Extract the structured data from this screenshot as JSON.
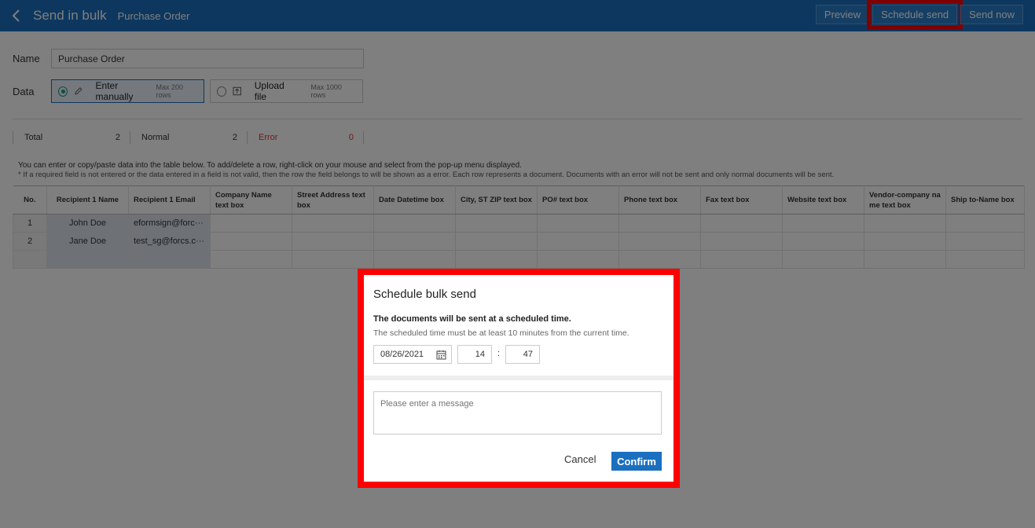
{
  "header": {
    "title": "Send in bulk",
    "subtitle": "Purchase Order",
    "actions": {
      "preview": "Preview",
      "schedule": "Schedule send",
      "send_now": "Send now"
    }
  },
  "form": {
    "name_label": "Name",
    "name_value": "Purchase Order",
    "data_label": "Data",
    "options": [
      {
        "label": "Enter manually",
        "max": "Max 200 rows"
      },
      {
        "label": "Upload file",
        "max": "Max 1000 rows"
      }
    ]
  },
  "stats": [
    {
      "label": "Total",
      "value": "2"
    },
    {
      "label": "Normal",
      "value": "2"
    },
    {
      "label": "Error",
      "value": "0"
    }
  ],
  "hint": {
    "line1": "You can enter or copy/paste data into the table below. To add/delete a row, right-click on your mouse and select from the pop-up menu displayed.",
    "line2": "* If a required field is not entered or the data entered in a field is not valid, then the row the field belongs to will be shown as a error. Each row represents a document. Documents with an error will not be sent and only normal documents will be sent."
  },
  "table": {
    "headers": [
      "No.",
      "Recipient 1 Name",
      "Recipient 1 Email",
      "Company Name text box",
      "Street Address text box",
      "Date Datetime box",
      "City, ST ZIP text box",
      "PO# text box",
      "Phone text box",
      "Fax text box",
      "Website text box",
      "Vendor-company na me text box",
      "Ship to-Name box"
    ],
    "rows": [
      {
        "no": "1",
        "name": "John Doe",
        "email": "eformsign@forc···"
      },
      {
        "no": "2",
        "name": "Jane Doe",
        "email": "test_sg@forcs.c···"
      }
    ]
  },
  "dialog": {
    "title": "Schedule bulk send",
    "text": "The documents will be sent at a scheduled time.",
    "subtext": "The scheduled time must be at least 10 minutes from the current time.",
    "date": "08/26/2021",
    "hour": "14",
    "minute": "47",
    "colon": ":",
    "message_placeholder": "Please enter a message",
    "cancel": "Cancel",
    "confirm": "Confirm"
  },
  "colors": {
    "header_bg": "#1a6fbf",
    "accent": "#1a6fbf",
    "error": "#d33333",
    "highlight": "#ff0000"
  }
}
